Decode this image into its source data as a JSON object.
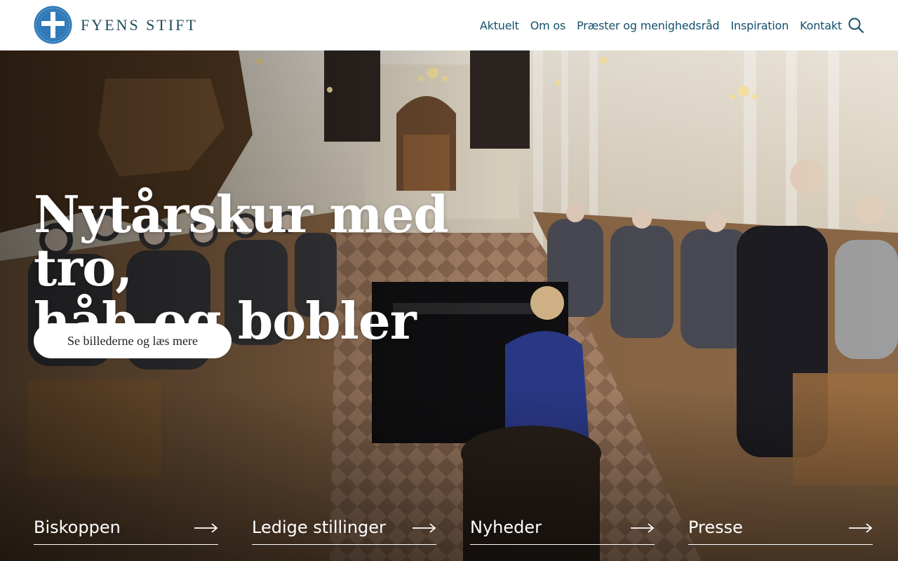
{
  "header": {
    "logo_text": "FYENS STIFT",
    "logo_icon": "cross-emblem-icon",
    "nav": [
      {
        "label": "Aktuelt"
      },
      {
        "label": "Om os"
      },
      {
        "label": "Præster og menighedsråd"
      },
      {
        "label": "Inspiration"
      },
      {
        "label": "Kontakt"
      }
    ],
    "search_icon": "search-icon"
  },
  "hero": {
    "title_line1": "Nytårskur med tro,",
    "title_line2": "håb og bobler",
    "cta_label": "Se billederne og læs mere",
    "quicklinks": [
      {
        "label": "Biskoppen",
        "icon": "arrow-right-icon"
      },
      {
        "label": "Ledige stillinger",
        "icon": "arrow-right-icon"
      },
      {
        "label": "Nyheder",
        "icon": "arrow-right-icon"
      },
      {
        "label": "Presse",
        "icon": "arrow-right-icon"
      }
    ]
  },
  "colors": {
    "brand": "#13506b",
    "logo_blue": "#2f79b8",
    "white": "#ffffff"
  }
}
